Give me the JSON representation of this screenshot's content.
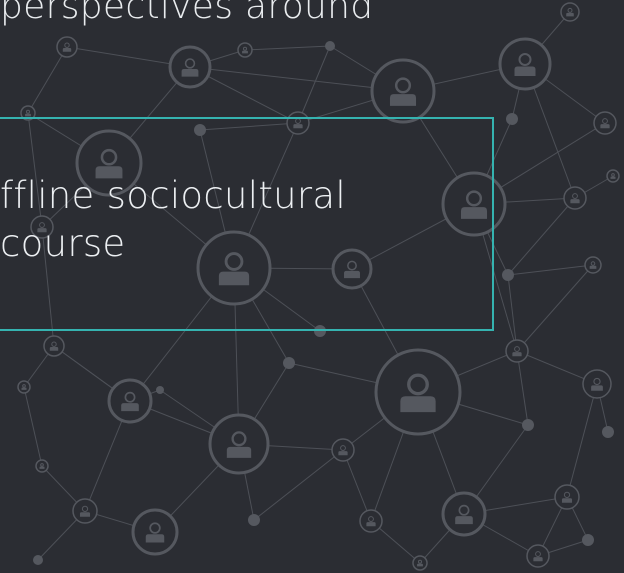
{
  "slide": {
    "text_fragment_top": "perspectives around",
    "box_line_1": "ffline sociocultural",
    "box_line_2": "course"
  },
  "colors": {
    "background": "#2b2d33",
    "text": "#eceff2",
    "box_border": "#35b3b0",
    "network_lines": "#4d5057",
    "network_nodes": "#55585f"
  },
  "background_graphic": {
    "type": "social-network-graph",
    "node_icon": "person-icon"
  }
}
